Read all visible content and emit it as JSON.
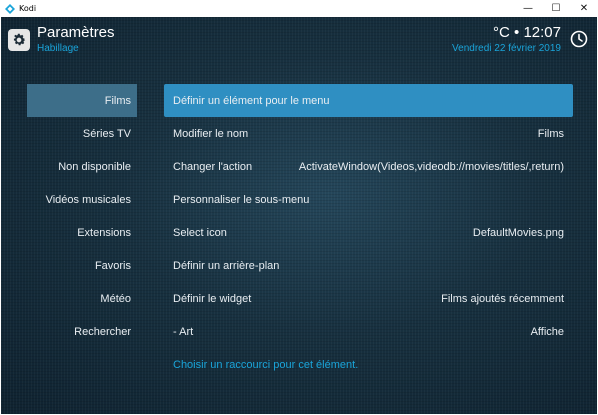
{
  "window": {
    "title": "Kodi",
    "controls": {
      "minimize": "—",
      "maximize": "☐",
      "close": "✕"
    }
  },
  "header": {
    "title": "Paramètres",
    "subtitle": "Habillage",
    "time": "°C • 12:07",
    "date": "Vendredi 22 février 2019"
  },
  "sidebar": {
    "items": [
      {
        "label": "Films",
        "active": true
      },
      {
        "label": "Séries TV"
      },
      {
        "label": "Non disponible"
      },
      {
        "label": "Vidéos musicales"
      },
      {
        "label": "Extensions"
      },
      {
        "label": "Favoris"
      },
      {
        "label": "Météo"
      },
      {
        "label": "Rechercher"
      }
    ]
  },
  "menu": {
    "rows": [
      {
        "label": "Définir un élément pour le menu",
        "value": ""
      },
      {
        "label": "Modifier le nom",
        "value": "Films"
      },
      {
        "label": "Changer l'action",
        "value": "ActivateWindow(Videos,videodb://movies/titles/,return)"
      },
      {
        "label": "Personnaliser le sous-menu",
        "value": ""
      },
      {
        "label": "Select icon",
        "value": "DefaultMovies.png"
      },
      {
        "label": "Définir un arrière-plan",
        "value": ""
      },
      {
        "label": "Définir le widget",
        "value": "Films ajoutés récemment"
      },
      {
        "label": "- Art",
        "value": "Affiche"
      },
      {
        "label": "Choisir un raccourci pour cet élément.",
        "value": ""
      }
    ]
  },
  "colors": {
    "accent": "#2f8fc2",
    "sidebar_active": "#3d6e89",
    "link": "#1aa4d9",
    "background": "#17303f"
  },
  "icons": {
    "app": "kodi-logo-icon",
    "settings": "gear-icon",
    "clock": "clock-icon"
  }
}
